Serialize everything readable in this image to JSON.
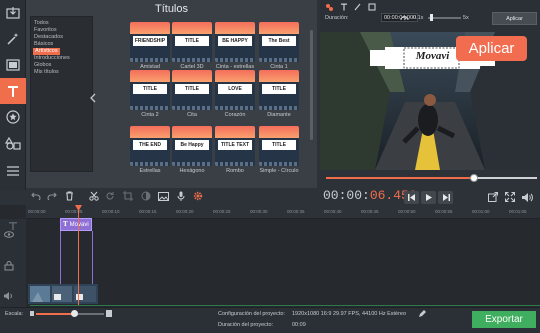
{
  "panel": {
    "title": "Títulos",
    "categories": [
      "Todos",
      "Favoritos",
      "Destacados",
      "Básicos",
      "Artísticos",
      "Introducciones",
      "Globos",
      "Mis títulos"
    ],
    "selected_category": "Artísticos",
    "thumbnails": [
      {
        "label": "Amistad",
        "text": "FRIENDSHIP"
      },
      {
        "label": "Cartel 3D",
        "text": "TITLE"
      },
      {
        "label": "Cinta - estrellas",
        "text": "BE HAPPY"
      },
      {
        "label": "Cinta 1",
        "text": "The Best"
      },
      {
        "label": "Cinta 2",
        "text": "TITLE"
      },
      {
        "label": "Cita",
        "text": "TITLE"
      },
      {
        "label": "Corazón",
        "text": "LOVE"
      },
      {
        "label": "Diamante",
        "text": "TITLE"
      },
      {
        "label": "Estrellas",
        "text": "THE END"
      },
      {
        "label": "Hexágono",
        "text": "Be Happy"
      },
      {
        "label": "Rombo",
        "text": "TITLE TEXT"
      },
      {
        "label": "Simple - Círculo",
        "text": "TITLE"
      }
    ]
  },
  "preview": {
    "duration_label": "Duración:",
    "duration_value": "00:00:04.000",
    "speed_min": "0.1x",
    "speed_max": "5x",
    "apply_label": "Aplicar",
    "tooltip": "Aplicar",
    "overlay_title": "Movavi",
    "progress": 0.7
  },
  "playback": {
    "timecode_main": "00:00:",
    "timecode_accent": "06.450"
  },
  "timeline": {
    "ticks": [
      "00:00:00",
      "00:00:05",
      "00:00:10",
      "00:00:15",
      "00:00:20",
      "00:00:25",
      "00:00:30",
      "00:00:35",
      "00:00:40",
      "00:00:45",
      "00:00:50",
      "00:00:55",
      "00:01:00",
      "00:01:05"
    ],
    "title_clip": "Movavi"
  },
  "footer": {
    "zoom_label": "Escala:",
    "zoom_level": 0.56,
    "config_label": "Configuración del proyecto:",
    "config_value": "1920x1080 16:9 29.97 FPS, 44100 Hz Estéreo",
    "duration_label": "Duración del proyecto:",
    "duration_value": "00:09",
    "export_label": "Exportar"
  },
  "colors": {
    "accent": "#f06e4c",
    "export": "#3fae5e",
    "clip": "#8e6fd4"
  }
}
